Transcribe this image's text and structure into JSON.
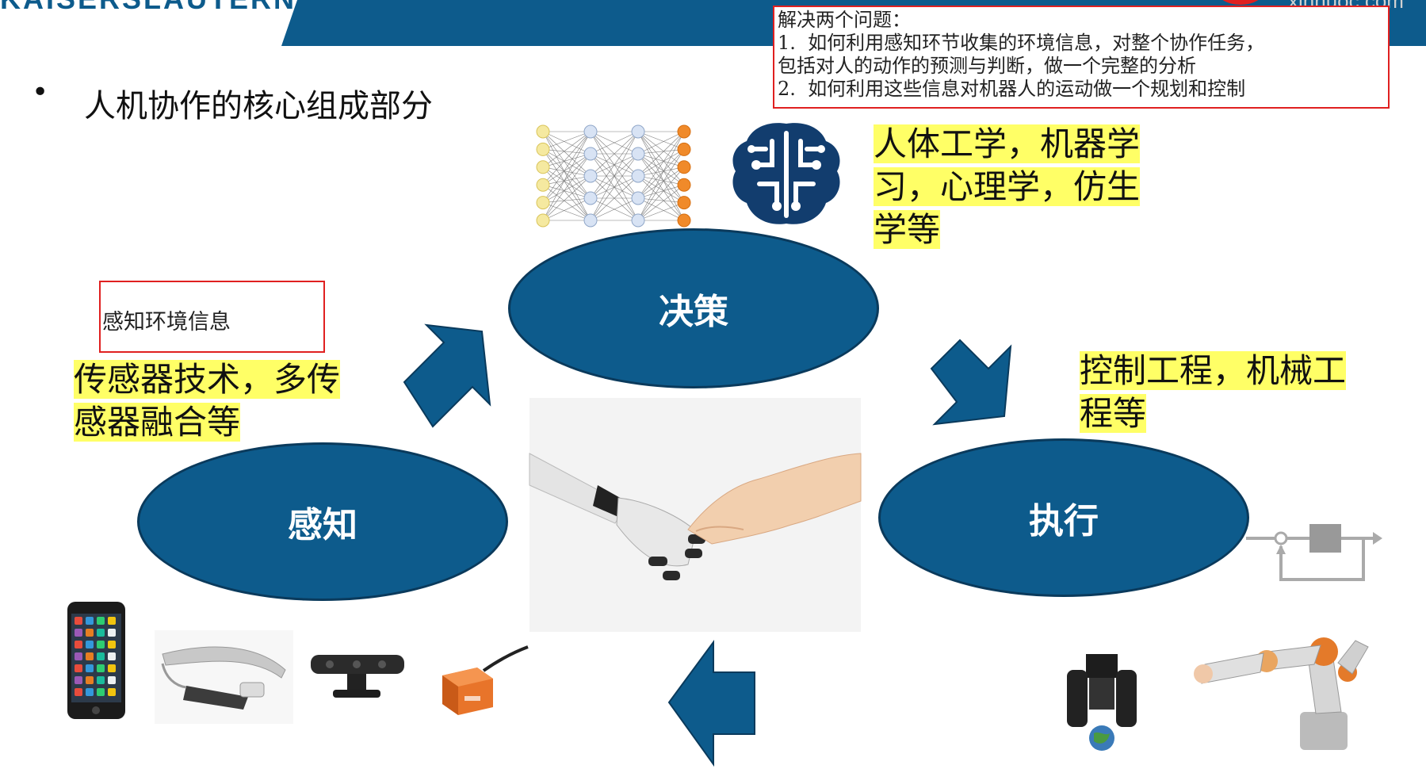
{
  "header": {
    "logo_text": "KAISERSLAUTERN",
    "site_text": "xinhuoc.com"
  },
  "note": {
    "text": "解决两个问题：\n1.  如何利用感知环节收集的环境信息，对整个协作任务，\n包括对人的动作的预测与判断，做一个完整的分析\n2.  如何利用这些信息对机器人的运动做一个规划和控制"
  },
  "slide": {
    "bullet": "•",
    "title": "人机协作的核心组成部分"
  },
  "cycle": {
    "decision": "决策",
    "perception": "感知",
    "execution": "执行"
  },
  "labels": {
    "perception_box": "感知环境信息",
    "perception_fields_line1": "传感器技术，多传",
    "perception_fields_line2": "感器融合等",
    "decision_fields_line1": "人体工学，机器学",
    "decision_fields_line2": "习，心理学，仿生",
    "decision_fields_line3": "学等",
    "execution_fields_line1": "控制工程，机械工",
    "execution_fields_line2": "程等"
  },
  "colors": {
    "brand_blue": "#0d5b8c",
    "highlight": "#ffff66",
    "red_border": "#e02020"
  },
  "icons": [
    "neural-network-icon",
    "brain-circuit-icon",
    "handshake-image",
    "smartphone-image",
    "smart-glasses-image",
    "depth-camera-image",
    "accelerometer-sensor-image",
    "robot-gripper-image",
    "robot-arm-image",
    "control-loop-diagram-icon"
  ]
}
